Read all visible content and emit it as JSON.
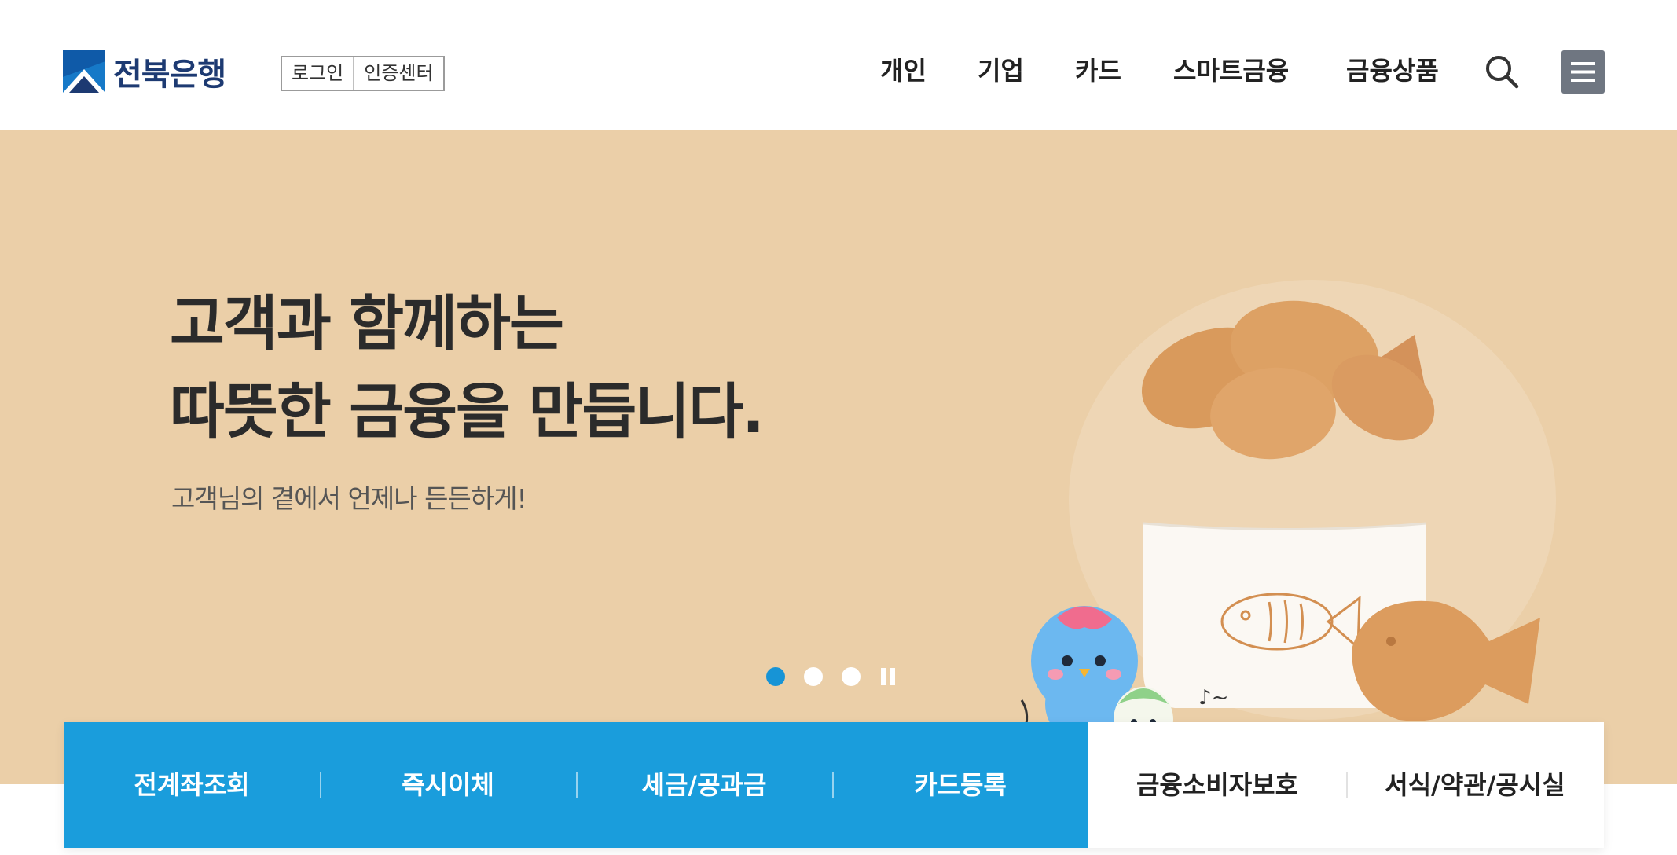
{
  "header": {
    "logo_text": "전북은행",
    "auth": {
      "login": "로그인",
      "cert_center": "인증센터"
    },
    "nav": [
      {
        "label": "개인"
      },
      {
        "label": "기업"
      },
      {
        "label": "카드"
      },
      {
        "label": "스마트금융"
      },
      {
        "label": "금융상품"
      }
    ],
    "icons": {
      "search": "search-icon",
      "menu": "hamburger-menu-icon"
    }
  },
  "hero": {
    "title_line1": "고객과 함께하는",
    "title_line2": "따뜻한 금융을 만듭니다.",
    "subtitle": "고객님의 곁에서 언제나 든든하게!",
    "slides": {
      "count": 3,
      "active_index": 0
    },
    "colors": {
      "background": "#ebcfa8",
      "dot_active": "#1794d6"
    }
  },
  "quick_menu": {
    "primary": [
      {
        "label": "전계좌조회"
      },
      {
        "label": "즉시이체"
      },
      {
        "label": "세금/공과금"
      },
      {
        "label": "카드등록"
      }
    ],
    "secondary": [
      {
        "label": "금융소비자보호"
      },
      {
        "label": "서식/약관/공시실"
      }
    ],
    "colors": {
      "primary_bg": "#1a9ddc",
      "secondary_bg": "#ffffff"
    }
  }
}
